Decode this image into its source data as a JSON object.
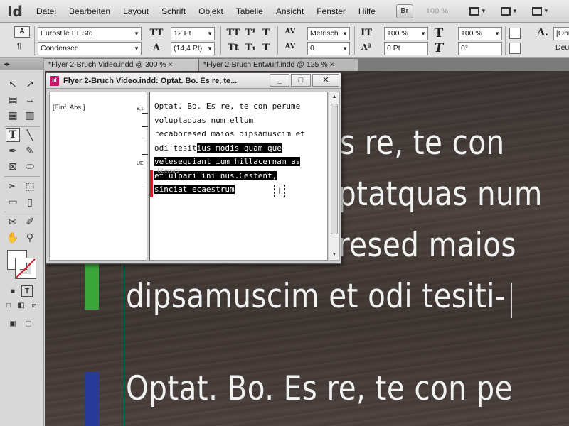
{
  "app": {
    "logo": "Id"
  },
  "menu": [
    "Datei",
    "Bearbeiten",
    "Layout",
    "Schrift",
    "Objekt",
    "Tabelle",
    "Ansicht",
    "Fenster",
    "Hilfe"
  ],
  "menu_right": {
    "bridge_label": "Br",
    "zoom": "100 %"
  },
  "control": {
    "font_family": "Eurostile LT Std",
    "font_style": "Condensed",
    "font_size": "12 Pt",
    "leading": "(14,4 Pt)",
    "kerning": "Metrisch",
    "tracking": "0",
    "vertical_scale": "100 %",
    "horizontal_scale": "100 %",
    "baseline_shift": "0 Pt",
    "skew": "0°",
    "style_right_1": "[Ohn",
    "style_right_2": "Deuts"
  },
  "tabs": [
    {
      "label": "*Flyer 2-Bruch Video.indd @ 300 %",
      "close": "×"
    },
    {
      "label": "*Flyer 2-Bruch Entwurf.indd @ 125 %",
      "close": "×"
    }
  ],
  "canvas_lines": [
    "s re, te con",
    "ptatquas num",
    "resed maios",
    "dipsamuscim et odi tesiti-",
    "Optat. Bo. Es re, te con pe"
  ],
  "story_editor": {
    "icon_label": "Id",
    "title": "Flyer 2-Bruch Video.indd: Optat. Bo. Es re, te...",
    "minimize": "_",
    "maximize": "□",
    "close": "✕",
    "paragraph_style": "[Einf. Abs.]",
    "ruler_top": "8,1",
    "ruler_bottom": "UE",
    "overset_label": "Übersatz",
    "text": {
      "line1": "Optat. Bo. Es re, te con perume",
      "line2": "voluptaquas num ellum",
      "line3": "recaboresed maios dipsamuscim et",
      "line4a": "odi tesit",
      "line4b": "ius modis quam que",
      "line5": "velesequiant ium hillacernam as",
      "line6": "et ulpari ini nus.Cestent,",
      "line7": "sinciat ecaestrum"
    }
  },
  "colors": {
    "guide": "#4ad0d8",
    "marker_green": "#3aa53a",
    "marker_blue": "#2a3a9a",
    "overset": "#d0202a",
    "app_icon": "#c8176a"
  }
}
